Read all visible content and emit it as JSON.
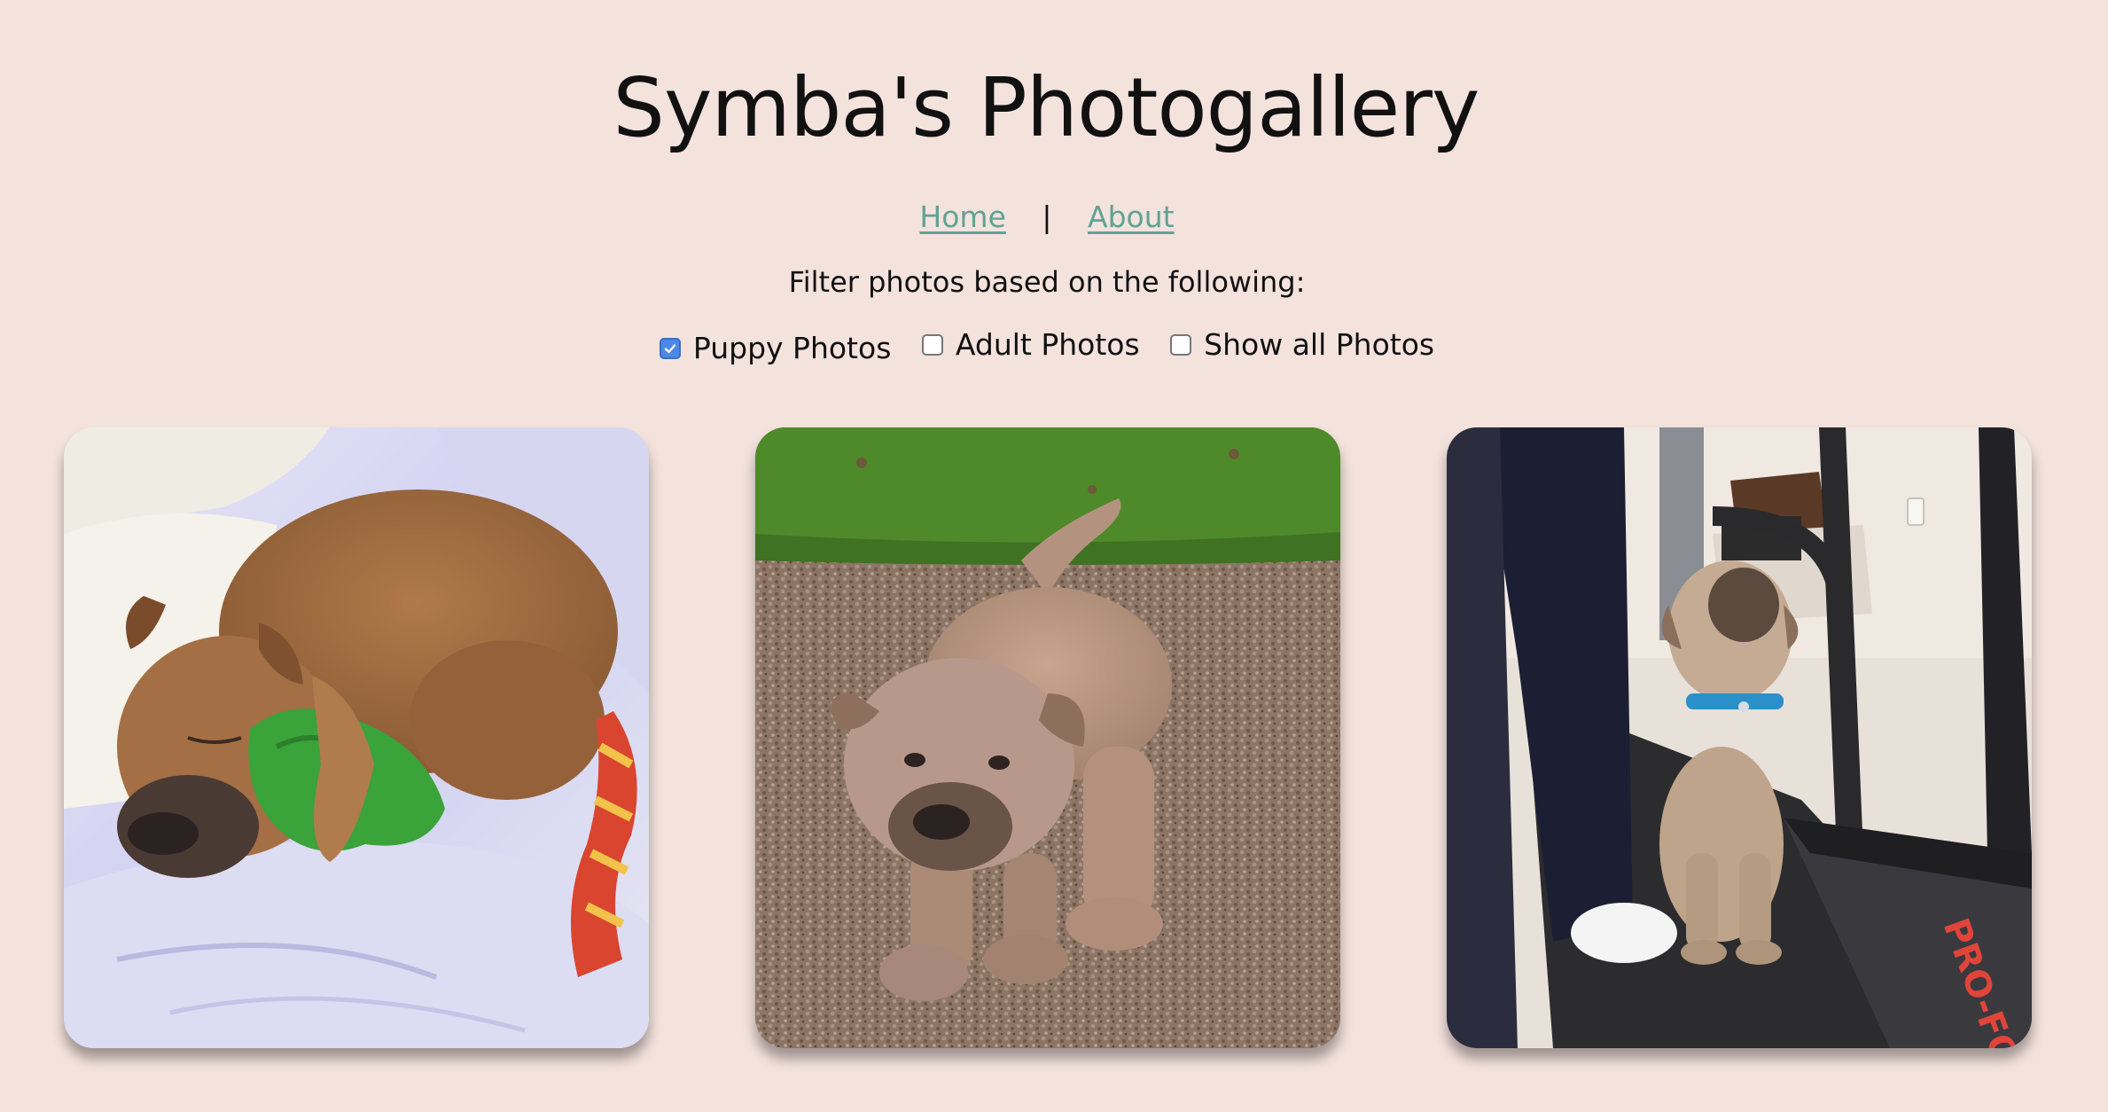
{
  "page": {
    "title": "Symba's Photogallery"
  },
  "nav": {
    "home_label": "Home",
    "separator": "|",
    "about_label": "About"
  },
  "filters": {
    "label": "Filter photos based on the following:",
    "options": [
      {
        "label": "Puppy Photos",
        "checked": true
      },
      {
        "label": "Adult Photos",
        "checked": false
      },
      {
        "label": "Show all Photos",
        "checked": false
      }
    ]
  },
  "gallery": {
    "photos": [
      {
        "subject": "brown dog sleeping on a white bed hugging a green toy"
      },
      {
        "subject": "tan puppy walking on gravel with grass behind"
      },
      {
        "subject": "tan puppy with blue collar sitting on a treadmill next to a person"
      }
    ]
  },
  "colors": {
    "background": "#f4e2dd",
    "link": "#5fa394",
    "checkbox_checked": "#4c88e6"
  }
}
